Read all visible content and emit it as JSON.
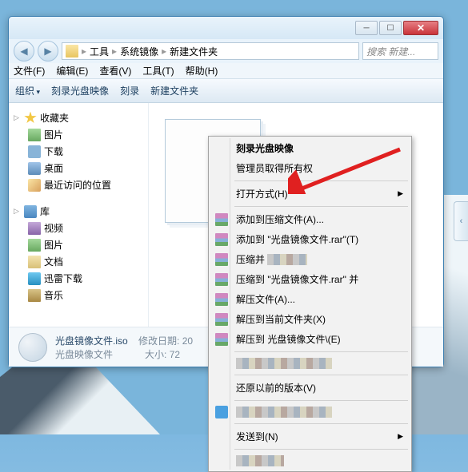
{
  "breadcrumb": {
    "parts": [
      "工具",
      "系统镜像",
      "新建文件夹"
    ]
  },
  "search": {
    "placeholder": "搜索 新建..."
  },
  "menubar": {
    "file": "文件(F)",
    "edit": "编辑(E)",
    "view": "查看(V)",
    "tools": "工具(T)",
    "help": "帮助(H)"
  },
  "toolbar": {
    "organize": "组织",
    "burn": "刻录光盘映像",
    "burn2": "刻录",
    "newfolder": "新建文件夹"
  },
  "sidebar": {
    "fav": {
      "head": "收藏夹",
      "items": [
        "图片",
        "下载",
        "桌面",
        "最近访问的位置"
      ]
    },
    "lib": {
      "head": "库",
      "items": [
        "视频",
        "图片",
        "文档",
        "迅雷下载",
        "音乐"
      ]
    }
  },
  "details": {
    "filename": "光盘镜像文件.iso",
    "filetype": "光盘映像文件",
    "date_label": "修改日期:",
    "date_val": "20",
    "size_label": "大小:",
    "size_val": "72"
  },
  "context": {
    "burn": "刻录光盘映像",
    "admin": "管理员取得所有权",
    "open_with": "打开方式(H)",
    "add_archive": "添加到压缩文件(A)...",
    "add_rar": "添加到 \"光盘镜像文件.rar\"(T)",
    "compress_email": "压缩并",
    "compress_rar": "压缩到 \"光盘镜像文件.rar\" 并",
    "extract": "解压文件(A)...",
    "extract_here": "解压到当前文件夹(X)",
    "extract_to": "解压到 光盘镜像文件\\(E)",
    "restore": "还原以前的版本(V)",
    "send_to": "发送到(N)"
  }
}
